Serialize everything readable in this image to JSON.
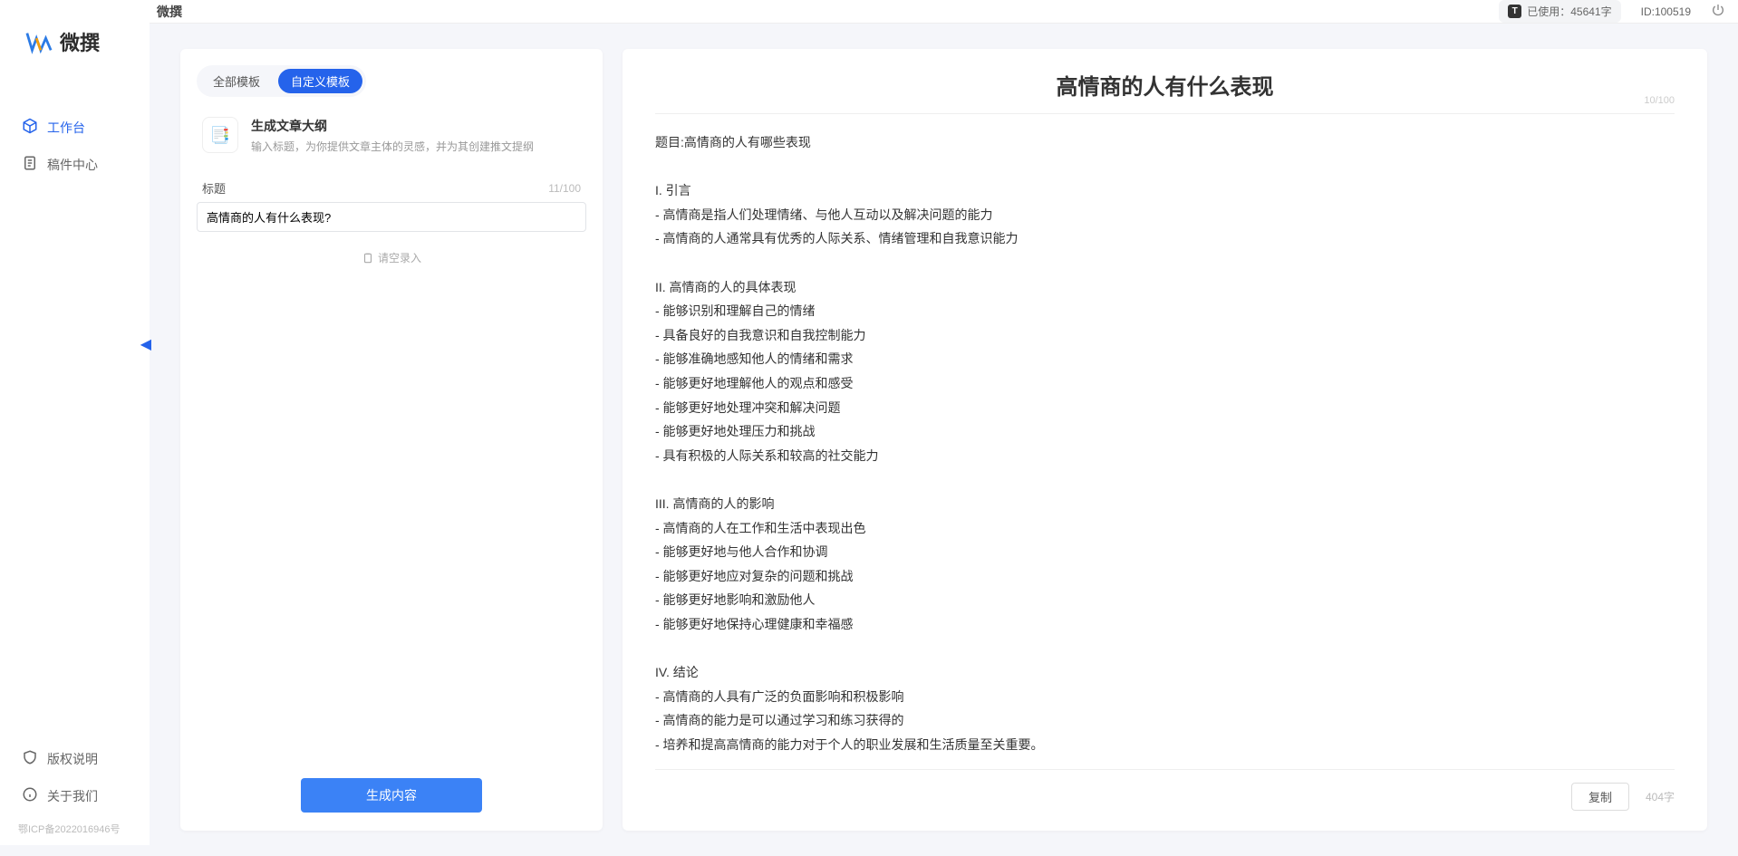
{
  "brand": {
    "name": "微撰"
  },
  "sidebar": {
    "items": [
      {
        "label": "工作台",
        "active": true
      },
      {
        "label": "稿件中心",
        "active": false
      }
    ],
    "footer": [
      {
        "label": "版权说明"
      },
      {
        "label": "关于我们"
      }
    ],
    "icp": "鄂ICP备2022016946号"
  },
  "topbar": {
    "title": "微撰",
    "usage": "已使用：45641字",
    "user_id": "ID:100519"
  },
  "left": {
    "tabs": [
      {
        "label": "全部模板",
        "active": false
      },
      {
        "label": "自定义模板",
        "active": true
      }
    ],
    "card": {
      "title": "生成文章大纲",
      "subtitle": "输入标题，为你提供文章主体的灵感，并为其创建推文提纲",
      "icon_glyph": "📑"
    },
    "field_label": "标题",
    "field_counter": "11/100",
    "field_value": "高情商的人有什么表现?",
    "extra_hint": "请空录入",
    "generate_button": "生成内容"
  },
  "output": {
    "title": "高情商的人有什么表现",
    "title_counter": "10/100",
    "body": "题目:高情商的人有哪些表现\n\nI. 引言\n- 高情商是指人们处理情绪、与他人互动以及解决问题的能力\n- 高情商的人通常具有优秀的人际关系、情绪管理和自我意识能力\n\nII. 高情商的人的具体表现\n- 能够识别和理解自己的情绪\n- 具备良好的自我意识和自我控制能力\n- 能够准确地感知他人的情绪和需求\n- 能够更好地理解他人的观点和感受\n- 能够更好地处理冲突和解决问题\n- 能够更好地处理压力和挑战\n- 具有积极的人际关系和较高的社交能力\n\nIII. 高情商的人的影响\n- 高情商的人在工作和生活中表现出色\n- 能够更好地与他人合作和协调\n- 能够更好地应对复杂的问题和挑战\n- 能够更好地影响和激励他人\n- 能够更好地保持心理健康和幸福感\n\nIV. 结论\n- 高情商的人具有广泛的负面影响和积极影响\n- 高情商的能力是可以通过学习和练习获得的\n- 培养和提高高情商的能力对于个人的职业发展和生活质量至关重要。",
    "copy_button": "复制",
    "word_count": "404字"
  }
}
